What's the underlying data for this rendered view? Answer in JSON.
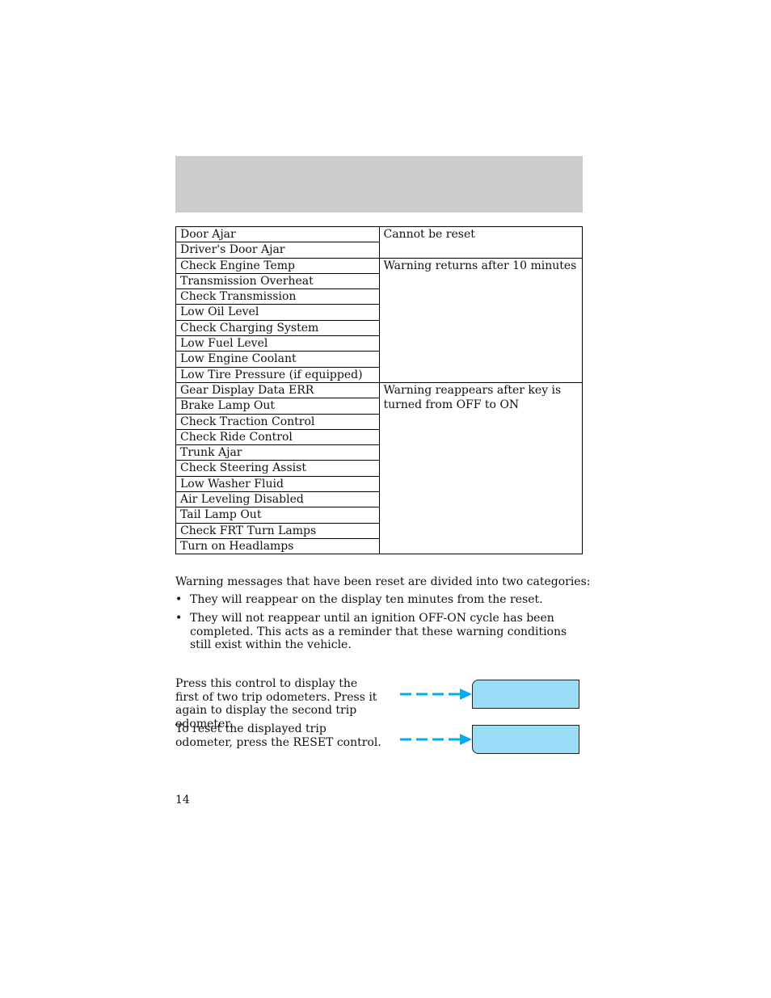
{
  "table": {
    "groups": [
      {
        "status": "Cannot be reset",
        "messages": [
          "Door Ajar",
          "Driver's Door Ajar"
        ]
      },
      {
        "status": "Warning returns after 10 minutes",
        "messages": [
          "Check Engine Temp",
          "Transmission Overheat",
          "Check Transmission",
          "Low Oil Level",
          "Check Charging System",
          "Low Fuel Level",
          "Low Engine Coolant",
          "Low Tire Pressure (if equipped)"
        ]
      },
      {
        "status": "Warning reappears after key is turned from OFF to ON",
        "messages": [
          "Gear Display Data ERR",
          "Brake Lamp Out",
          "Check Traction Control",
          "Check Ride Control",
          "Trunk Ajar",
          "Check Steering Assist",
          "Low Washer Fluid",
          "Air Leveling Disabled",
          "Tail Lamp Out",
          "Check FRT Turn Lamps",
          "Turn on Headlamps"
        ]
      }
    ]
  },
  "intro": "Warning messages that have been reset are divided into two categories:",
  "bullets": [
    "They will reappear on the display ten minutes from the reset.",
    "They will not reappear until an ignition OFF-ON cycle has been completed. This acts as a reminder that these warning conditions still exist within the vehicle."
  ],
  "controls": [
    {
      "text": "Press this control to display the first of two trip odometers. Press it again to display the second trip odometer."
    },
    {
      "text": "To reset the displayed trip odometer, press the RESET control."
    }
  ],
  "colors": {
    "arrow": "#00aeef",
    "button_fill": "#99ddf6",
    "header_band": "#cccccc"
  },
  "page_number": "14"
}
